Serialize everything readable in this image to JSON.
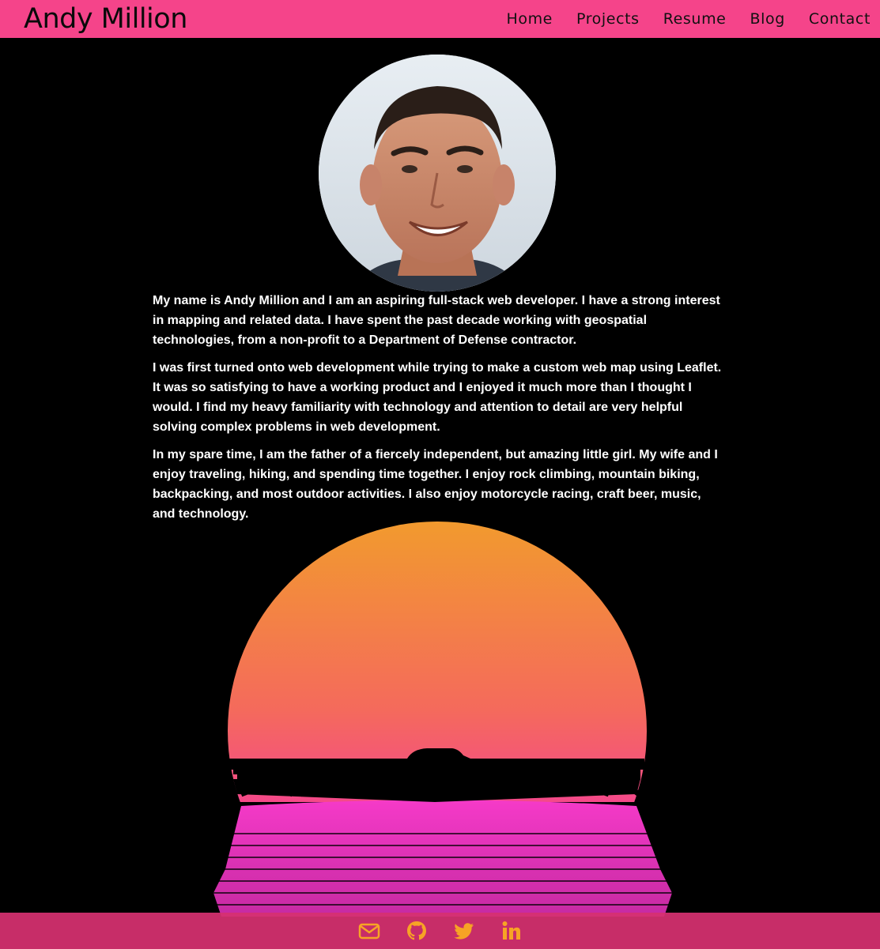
{
  "header": {
    "brand": "Andy Million",
    "nav": [
      {
        "label": "Home"
      },
      {
        "label": "Projects"
      },
      {
        "label": "Resume"
      },
      {
        "label": "Blog"
      },
      {
        "label": "Contact"
      }
    ]
  },
  "about": {
    "paragraphs": [
      "My name is Andy Million and I am an aspiring full-stack web developer. I have a strong interest in mapping and related data. I have spent the past decade working with geospatial technologies, from a non-profit to a Department of Defense contractor.",
      "I was first turned onto web development while trying to make a custom web map using Leaflet. It was so satisfying to have a working product and I enjoyed it much more than I thought I would. I find my heavy familiarity with technology and attention to detail are very helpful solving complex problems in web development.",
      "In my spare time, I am the father of a fiercely independent, but amazing little girl. My wife and I enjoy traveling, hiking, and spending time together. I enjoy rock climbing, mountain biking, backpacking, and most outdoor activities. I also enjoy motorcycle racing, craft beer, music, and technology."
    ]
  },
  "footer": {
    "icons": [
      "envelope-icon",
      "github-icon",
      "twitter-icon",
      "linkedin-icon"
    ]
  },
  "colors": {
    "nav_bg": "#f5448a",
    "footer_bg": "#d63070",
    "icon": "#f7a325",
    "sun_top": "#f29a2e",
    "sun_bottom": "#f53ac8"
  }
}
